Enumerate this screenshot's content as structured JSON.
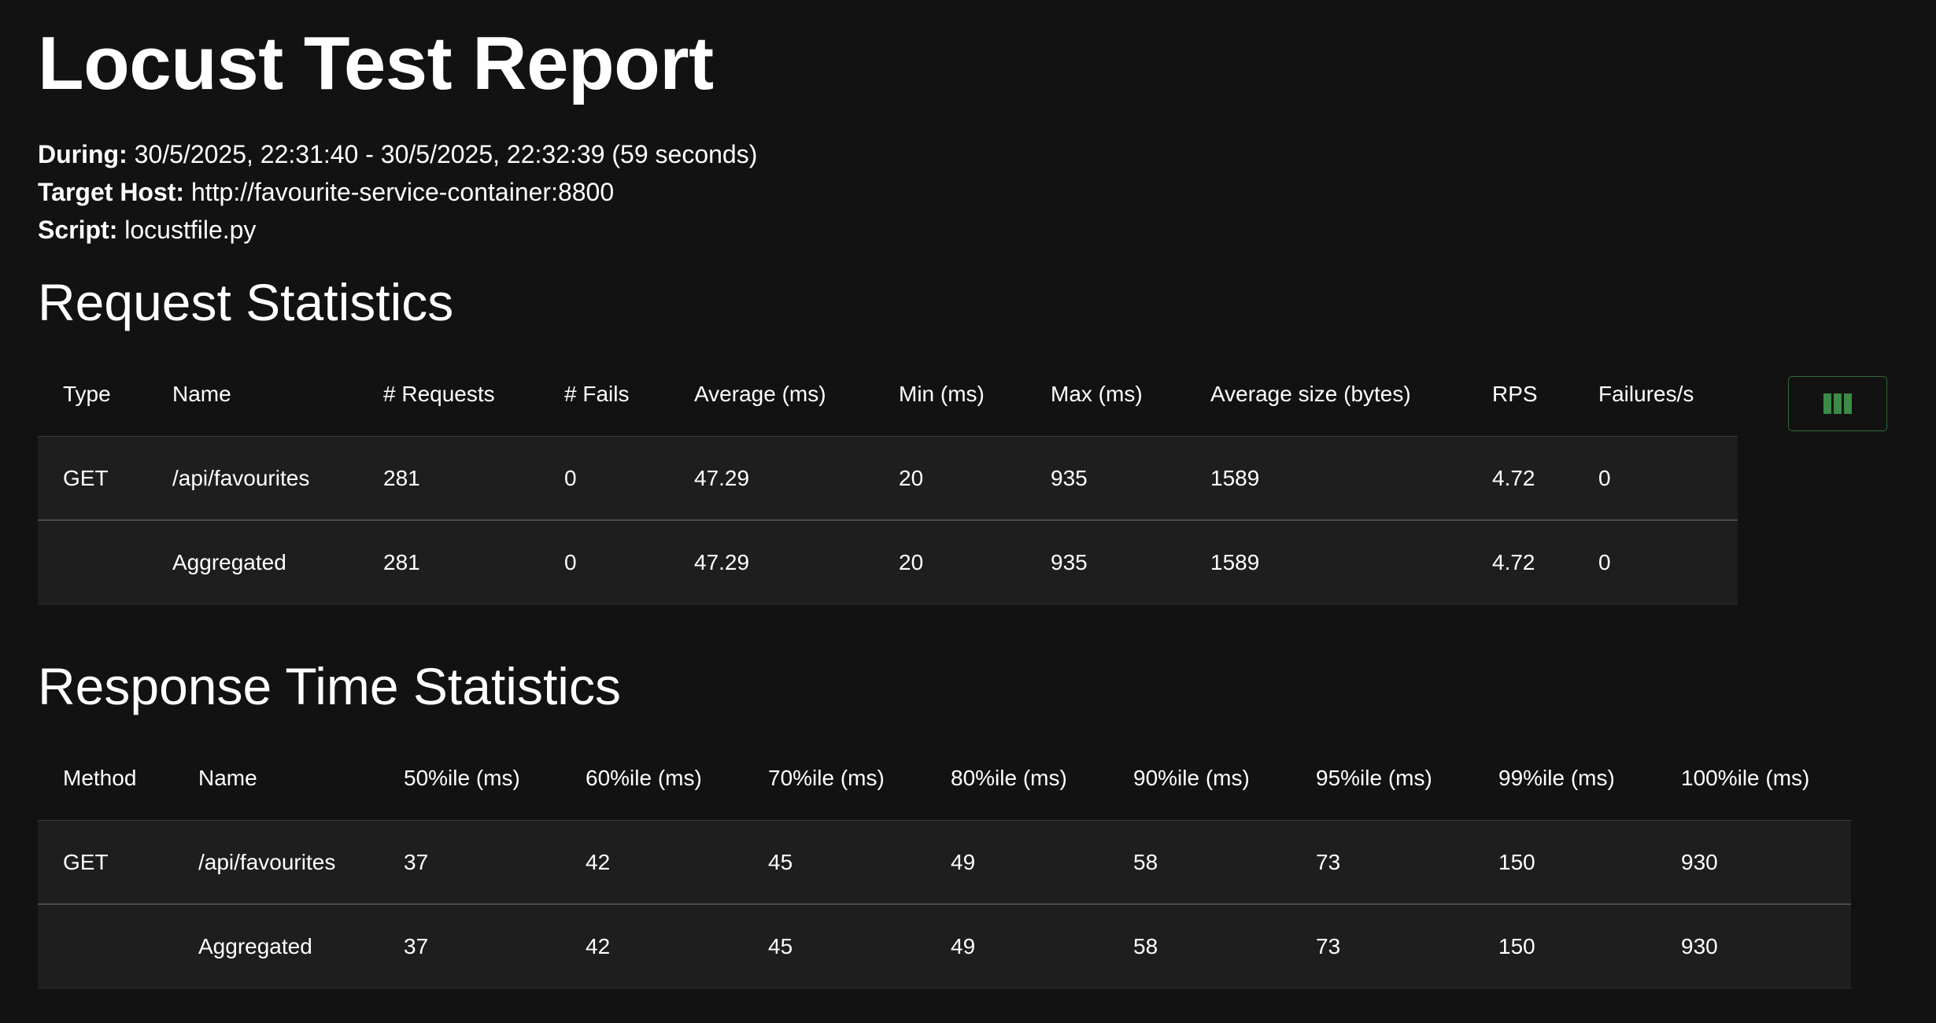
{
  "title": "Locust Test Report",
  "meta": {
    "during_label": "During:",
    "during_value": "30/5/2025, 22:31:40 - 30/5/2025, 22:32:39 (59 seconds)",
    "host_label": "Target Host:",
    "host_value": "http://favourite-service-container:8800",
    "script_label": "Script:",
    "script_value": "locustfile.py"
  },
  "request_stats": {
    "heading": "Request Statistics",
    "columns": [
      "Type",
      "Name",
      "# Requests",
      "# Fails",
      "Average (ms)",
      "Min (ms)",
      "Max (ms)",
      "Average size (bytes)",
      "RPS",
      "Failures/s"
    ],
    "rows": [
      [
        "GET",
        "/api/favourites",
        "281",
        "0",
        "47.29",
        "20",
        "935",
        "1589",
        "4.72",
        "0"
      ],
      [
        "",
        "Aggregated",
        "281",
        "0",
        "47.29",
        "20",
        "935",
        "1589",
        "4.72",
        "0"
      ]
    ],
    "columns_button_icon": "view-columns-icon",
    "accent_color": "#3b8a46"
  },
  "response_stats": {
    "heading": "Response Time Statistics",
    "columns": [
      "Method",
      "Name",
      "50%ile (ms)",
      "60%ile (ms)",
      "70%ile (ms)",
      "80%ile (ms)",
      "90%ile (ms)",
      "95%ile (ms)",
      "99%ile (ms)",
      "100%ile (ms)"
    ],
    "rows": [
      [
        "GET",
        "/api/favourites",
        "37",
        "42",
        "45",
        "49",
        "58",
        "73",
        "150",
        "930"
      ],
      [
        "",
        "Aggregated",
        "37",
        "42",
        "45",
        "49",
        "58",
        "73",
        "150",
        "930"
      ]
    ]
  }
}
